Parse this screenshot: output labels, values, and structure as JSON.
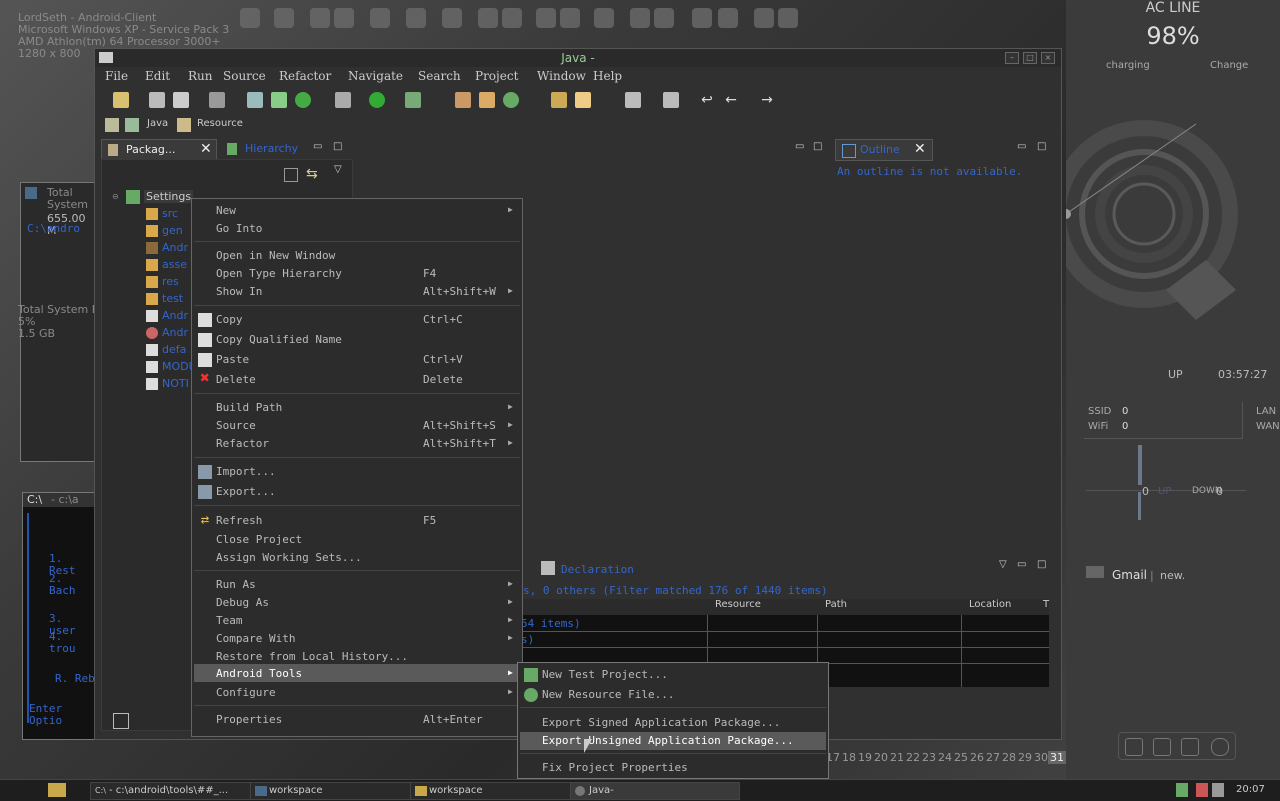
{
  "desktop": {
    "info_lines": [
      "LordSeth - Android-Client",
      "Microsoft Windows XP - Service Pack 3",
      "AMD Athlon(tm) 64 Processor 3000+",
      "1280 x 800"
    ],
    "left_text_1": "Total System",
    "left_text_2": "655.00 M",
    "left_text_3": "C:\\andro",
    "left_text_4": "Total System M",
    "left_text_5": "5%",
    "left_text_6": "1.5 GB",
    "cmd_title": "- c:\\a",
    "cmd_lines": [
      "1. Rest",
      "2. Bach",
      "3. user",
      "4. trou",
      "R. Reb",
      "Enter Optio"
    ],
    "calendar_days": [
      "17",
      "18",
      "19",
      "20",
      "21",
      "22",
      "23",
      "24",
      "25",
      "26",
      "27",
      "28",
      "29",
      "30",
      "31"
    ]
  },
  "sidebar": {
    "ac_line": "AC LINE",
    "battery": "98%",
    "charging": "charging",
    "change": "Change",
    "up_label": "UP",
    "uptime": "03:57:27",
    "ssid_label": "SSID",
    "ssid_value": "0",
    "wifi_label": "WiFi",
    "wifi_value": "0",
    "lan_label": "LAN",
    "wan_label": "WAN",
    "net_up_value": "0",
    "net_up_label": "UP",
    "net_down_label": "DOWN",
    "net_down_value": "0",
    "gmail_label": "Gmail",
    "gmail_sep": "|",
    "gmail_status": "new."
  },
  "window": {
    "title": "Java -",
    "menu": [
      "File",
      "Edit",
      "Run",
      "Source",
      "Refactor",
      "Navigate",
      "Search",
      "Project",
      "Window",
      "Help"
    ],
    "perspectives": [
      "Java",
      "Resource"
    ]
  },
  "package_explorer": {
    "tab_label": "Packag...",
    "hierarchy_tab": "Hierarchy",
    "project": "Settings",
    "items": [
      "src",
      "gen",
      "Andr",
      "asse",
      "res",
      "test",
      "Andr",
      "Andr",
      "defa",
      "MODU",
      "NOTI"
    ]
  },
  "outline": {
    "tab_label": "Outline",
    "message": "An outline is not available."
  },
  "problems": {
    "declaration_tab": "Declaration",
    "summary": "s, 0 others (Filter matched 176 of 1440 items)",
    "columns": [
      "Resource",
      "Path",
      "Location",
      "T"
    ],
    "row1": "54 items)",
    "row2": "s)"
  },
  "context_menu": {
    "items": [
      {
        "label": "New",
        "shortcut": "",
        "submenu": true
      },
      {
        "label": "Go Into",
        "shortcut": "",
        "submenu": false
      },
      {
        "label": "Open in New Window",
        "shortcut": "",
        "submenu": false
      },
      {
        "label": "Open Type Hierarchy",
        "shortcut": "F4",
        "submenu": false
      },
      {
        "label": "Show In",
        "shortcut": "Alt+Shift+W",
        "submenu": true
      },
      {
        "label": "Copy",
        "shortcut": "Ctrl+C",
        "submenu": false
      },
      {
        "label": "Copy Qualified Name",
        "shortcut": "",
        "submenu": false
      },
      {
        "label": "Paste",
        "shortcut": "Ctrl+V",
        "submenu": false
      },
      {
        "label": "Delete",
        "shortcut": "Delete",
        "submenu": false
      },
      {
        "label": "Build Path",
        "shortcut": "",
        "submenu": true
      },
      {
        "label": "Source",
        "shortcut": "Alt+Shift+S",
        "submenu": true
      },
      {
        "label": "Refactor",
        "shortcut": "Alt+Shift+T",
        "submenu": true
      },
      {
        "label": "Import...",
        "shortcut": "",
        "submenu": false
      },
      {
        "label": "Export...",
        "shortcut": "",
        "submenu": false
      },
      {
        "label": "Refresh",
        "shortcut": "F5",
        "submenu": false
      },
      {
        "label": "Close Project",
        "shortcut": "",
        "submenu": false
      },
      {
        "label": "Assign Working Sets...",
        "shortcut": "",
        "submenu": false
      },
      {
        "label": "Run As",
        "shortcut": "",
        "submenu": true
      },
      {
        "label": "Debug As",
        "shortcut": "",
        "submenu": true
      },
      {
        "label": "Team",
        "shortcut": "",
        "submenu": true
      },
      {
        "label": "Compare With",
        "shortcut": "",
        "submenu": true
      },
      {
        "label": "Restore from Local History...",
        "shortcut": "",
        "submenu": false
      },
      {
        "label": "Android Tools",
        "shortcut": "",
        "submenu": true
      },
      {
        "label": "Configure",
        "shortcut": "",
        "submenu": true
      },
      {
        "label": "Properties",
        "shortcut": "Alt+Enter",
        "submenu": false
      }
    ]
  },
  "android_submenu": {
    "items": [
      "New Test Project...",
      "New Resource File...",
      "Export Signed Application Package...",
      "Export Unsigned Application Package...",
      "Fix Project Properties"
    ]
  },
  "taskbar": {
    "tasks": [
      "- c:\\android\\tools\\##_...",
      "workspace",
      "workspace",
      "Java-"
    ],
    "clock": "20:07"
  },
  "colors": {
    "menu_bg": "#2c2c2c",
    "highlight": "#5a5a5a",
    "link_blue": "#3366cc"
  }
}
